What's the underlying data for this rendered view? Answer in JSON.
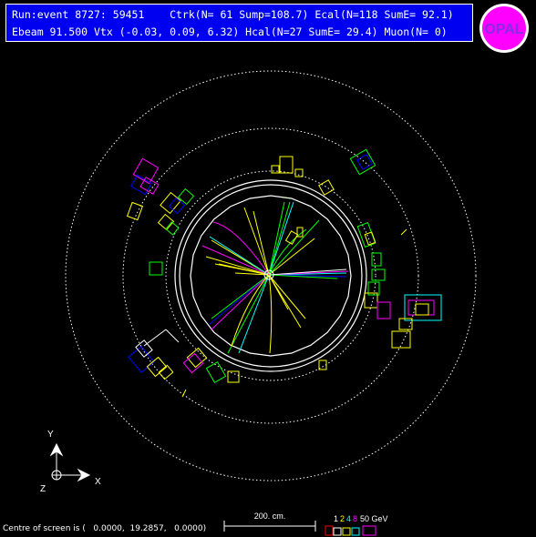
{
  "header": {
    "line1": "Run:event 8727: 59451    Ctrk(N= 61 Sump=108.7) Ecal(N=118 SumE= 92.1)",
    "line2": "Ebeam 91.500 Vtx (-0.03, 0.09, 6.32) Hcal(N=27 SumE= 29.4) Muon(N= 0)"
  },
  "logo": {
    "text": "OPAL",
    "colors": {
      "ring": "#ffffff",
      "fill": "#ff00ff",
      "inner": "#8a2be2"
    }
  },
  "axes": {
    "x_label": "X",
    "y_label": "Y",
    "z_label": "Z"
  },
  "scale": {
    "label": "200. cm."
  },
  "energy_legend": {
    "values": [
      "1",
      "2",
      "4",
      "8",
      "50 GeV"
    ],
    "colors": [
      "#ffffff",
      "#ffff00",
      "#00ffff",
      "#ff00ff",
      "#ffffff"
    ]
  },
  "footer": {
    "centre_text": "Centre of screen is (   0.0000,  19.2857,   0.0000)"
  },
  "colors": {
    "background": "#000000",
    "header_bg": "#0000f0",
    "track_yellow": "#ffff00",
    "track_green": "#00ff00",
    "track_cyan": "#00ffff",
    "track_magenta": "#ff00ff",
    "track_blue": "#0000ff",
    "detector_outline": "#ffffff"
  }
}
